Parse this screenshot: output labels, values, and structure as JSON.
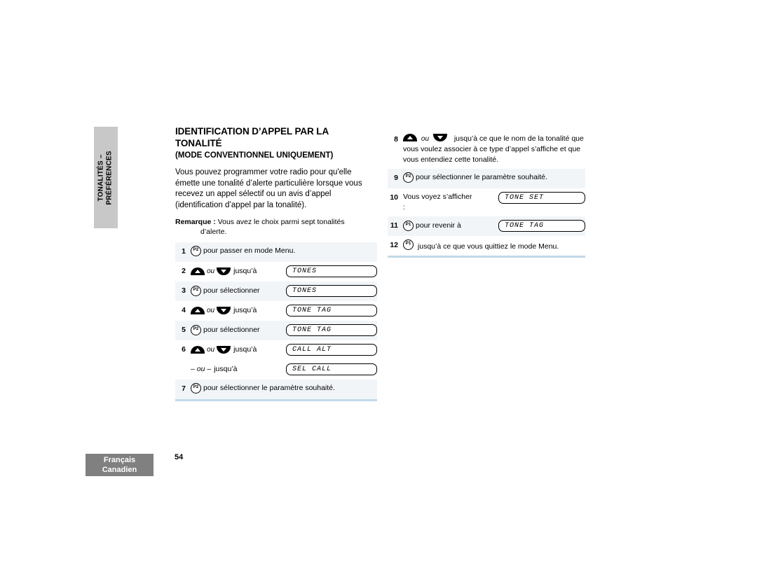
{
  "chapter_tab": {
    "line1": "TONALITÉS –",
    "line2": "PRÉFÉRENCES"
  },
  "footer": {
    "language_line1": "Français",
    "language_line2": "Canadien",
    "page_number": "54"
  },
  "colors": {
    "chapter_tab_bg": "#c8c8c8",
    "language_tab_bg": "#808080",
    "row_shade": "#f2f5f8",
    "panel_rule": "#c3d9e8"
  },
  "article": {
    "title": "IDENTIFICATION D’APPEL PAR LA TONALITÉ",
    "subtitle": "(MODE CONVENTIONNEL UNIQUEMENT)",
    "intro": "Vous pouvez programmer votre radio pour qu'elle émette une tonalité d’alerte particulière lorsque vous recevez un appel sélectif ou un avis d’appel (identification d’appel par la tonalité).",
    "note_label": "Remarque :",
    "note_text": "Vous avez le choix parmi sept tonalités",
    "note_text2": "d’alerte."
  },
  "steps_left": [
    {
      "num": "1",
      "icon": "p2-button-icon",
      "icon_label": "P2",
      "text": "pour passer en mode Menu.",
      "lcd": ""
    },
    {
      "num": "2",
      "icon": "updown-arrow-icons",
      "ou": "ou",
      "text": "jusqu’à",
      "lcd": "TONES"
    },
    {
      "num": "3",
      "icon": "p2-button-icon",
      "icon_label": "P2",
      "text": "pour sélectionner",
      "lcd": "TONES"
    },
    {
      "num": "4",
      "icon": "updown-arrow-icons",
      "ou": "ou",
      "text": "jusqu’à",
      "lcd": "TONE TAG"
    },
    {
      "num": "5",
      "icon": "p2-button-icon",
      "icon_label": "P2",
      "text": "pour sélectionner",
      "lcd": "TONE TAG"
    },
    {
      "num": "6",
      "icon": "updown-arrow-icons",
      "ou": "ou",
      "text": "jusqu’à",
      "lcd": "CALL ALT"
    },
    {
      "num": "",
      "icon": "none",
      "alt_prefix": "–",
      "alt_ou": "ou",
      "alt_suffix": "–",
      "text": "jusqu’à",
      "lcd": "SEL CALL"
    },
    {
      "num": "7",
      "icon": "p2-button-icon",
      "icon_label": "P2",
      "text": "pour sélectionner le paramètre souhaité.",
      "lcd": ""
    }
  ],
  "steps_right": [
    {
      "num": "8",
      "icon": "updown-arrow-icons",
      "ou": "ou",
      "text": "jusqu’à ce que le nom de la tonalité que vous voulez associer à ce type d’appel s’affiche et que vous entendiez cette tonalité.",
      "lcd": ""
    },
    {
      "num": "9",
      "icon": "p2-button-icon",
      "icon_label": "P2",
      "text": "pour sélectionner le paramètre souhaité.",
      "lcd": ""
    },
    {
      "num": "10",
      "icon": "none",
      "text": "Vous voyez s’afficher",
      "text2": ":",
      "lcd": "TONE SET"
    },
    {
      "num": "11",
      "icon": "p1-button-icon",
      "icon_label": "P1",
      "text": "pour revenir à",
      "lcd": "TONE TAG"
    },
    {
      "num": "12",
      "icon": "p1-button-icon",
      "icon_label": "P1",
      "text": "jusqu’à ce que vous quittiez le mode Menu.",
      "lcd": ""
    }
  ]
}
